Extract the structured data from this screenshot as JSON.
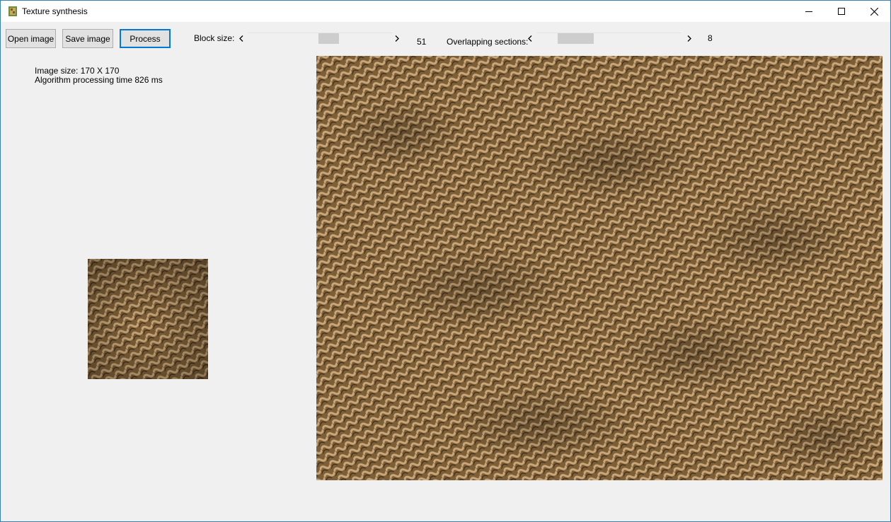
{
  "window": {
    "title": "Texture synthesis",
    "icon": "texture-app-icon",
    "controls": [
      "minimize-icon",
      "maximize-icon",
      "close-icon"
    ]
  },
  "toolbar": {
    "open_label": "Open image",
    "save_label": "Save image",
    "process_label": "Process",
    "block_size_label": "Block size:",
    "block_size_value": "51",
    "overlap_label": "Overlapping sections:",
    "overlap_value": "8"
  },
  "info": {
    "image_size": "Image size: 170 X 170",
    "processing_time": "Algorithm processing time 826 ms"
  },
  "colors": {
    "accent": "#0078d7",
    "window_border": "#3c7fb1",
    "texture_base": "#8a6a3f",
    "texture_highlight": "#c9a77a",
    "texture_shadow": "#3b2b18"
  }
}
